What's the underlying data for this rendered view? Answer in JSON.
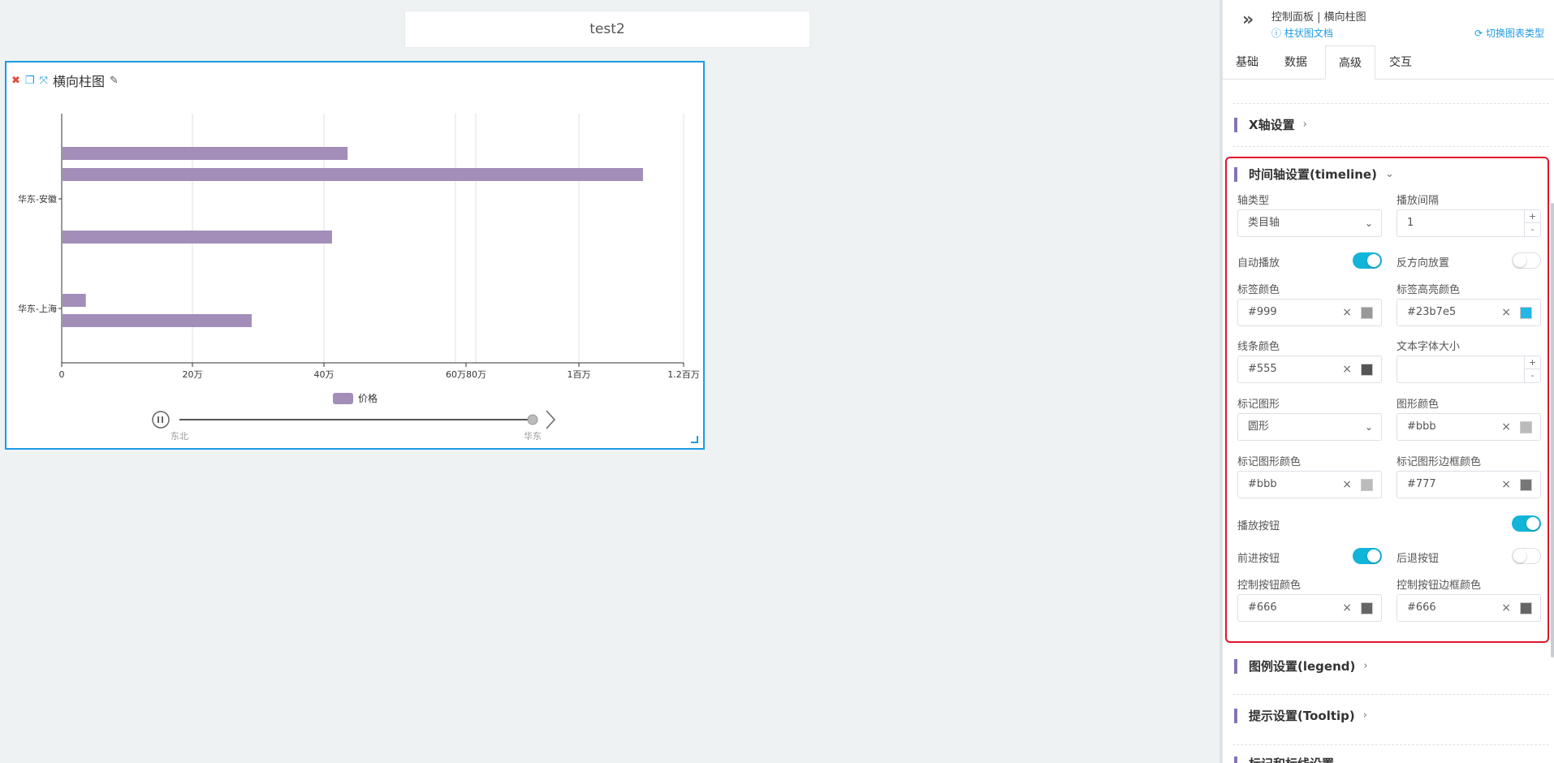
{
  "canvas": {
    "title": "test2"
  },
  "card": {
    "title": "横向柱图",
    "legend": "价格",
    "legend_color": "#a28eb9"
  },
  "chart_data": {
    "type": "bar",
    "orientation": "horizontal",
    "categories": [
      "华东-安徽",
      "华东-上海"
    ],
    "series": [
      {
        "name": "价格",
        "values": [
          550000,
          1120000,
          520000,
          45000,
          365000
        ]
      }
    ],
    "xticks": [
      "0",
      "20万",
      "40万",
      "60万",
      "80万",
      "1百万",
      "1.2百万"
    ],
    "xlim": [
      0,
      1200000
    ],
    "timeline": {
      "items": [
        "东北",
        "华东"
      ]
    },
    "grid": true,
    "bar_color": "#a28eb9"
  },
  "panel": {
    "header": {
      "title": "控制面板 | 横向柱图",
      "doc_link": "柱状图文档",
      "switch_link": "切换图表类型"
    },
    "tabs": [
      "基础",
      "数据",
      "高级",
      "交互"
    ],
    "active_tab": "高级",
    "sections": {
      "x_axis": "X轴设置",
      "timeline": "时间轴设置(timeline)",
      "legend": "图例设置(legend)",
      "tooltip": "提示设置(Tooltip)",
      "markline": "标记和标线设置"
    },
    "timeline": {
      "axis_type_label": "轴类型",
      "axis_type_value": "类目轴",
      "interval_label": "播放间隔",
      "interval_value": "1",
      "autoplay_label": "自动播放",
      "inverse_label": "反方向放置",
      "label_color_label": "标签颜色",
      "label_color_value": "#999",
      "label_color": "#999999",
      "highlight_color_label": "标签高亮颜色",
      "highlight_color_value": "#23b7e5",
      "highlight_color": "#23b7e5",
      "line_color_label": "线条颜色",
      "line_color_value": "#555",
      "line_color": "#555555",
      "font_size_label": "文本字体大小",
      "symbol_label": "标记图形",
      "symbol_value": "圆形",
      "shape_color_label": "图形颜色",
      "shape_color_value": "#bbb",
      "shape_color": "#bbbbbb",
      "symbol_color_label": "标记图形颜色",
      "symbol_color_value": "#bbb",
      "symbol_color": "#bbbbbb",
      "symbol_border_label": "标记图形边框颜色",
      "symbol_border_value": "#777",
      "symbol_border": "#777777",
      "play_btn_label": "播放按钮",
      "next_btn_label": "前进按钮",
      "prev_btn_label": "后退按钮",
      "ctrl_color_label": "控制按钮颜色",
      "ctrl_color_value": "#666",
      "ctrl_color": "#666666",
      "ctrl_border_label": "控制按钮边框颜色",
      "ctrl_border_value": "#666",
      "ctrl_border": "#666666"
    },
    "icons": {
      "collapse": "double-chevron-icon",
      "help": "question-circle-icon",
      "switch": "refresh-icon"
    }
  }
}
